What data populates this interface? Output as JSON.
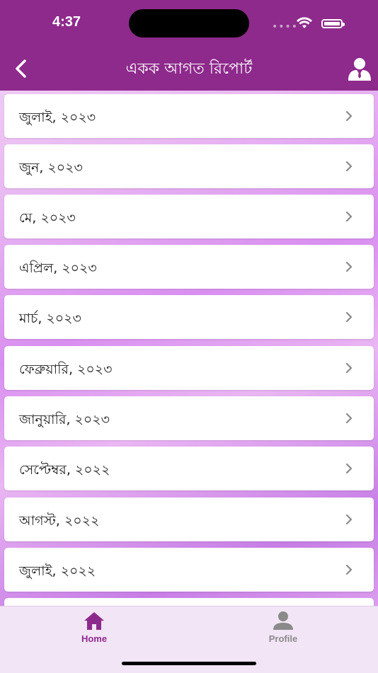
{
  "status": {
    "time": "4:37"
  },
  "header": {
    "title": "একক আগত রিপোর্ট"
  },
  "months": [
    "জুলাই, ২০২৩",
    "জুন, ২০২৩",
    "মে, ২০২৩",
    "এপ্রিল, ২০২৩",
    "মার্চ, ২০২৩",
    "ফেব্রুয়ারি, ২০২৩",
    "জানুয়ারি, ২০২৩",
    "সেপ্টেম্বর, ২০২২",
    "আগস্ট, ২০২২",
    "জুলাই, ২০২২"
  ],
  "tabs": {
    "home": {
      "label": "Home",
      "color": "#8e2a8c"
    },
    "profile": {
      "label": "Profile",
      "color": "#8a8a8a"
    }
  }
}
